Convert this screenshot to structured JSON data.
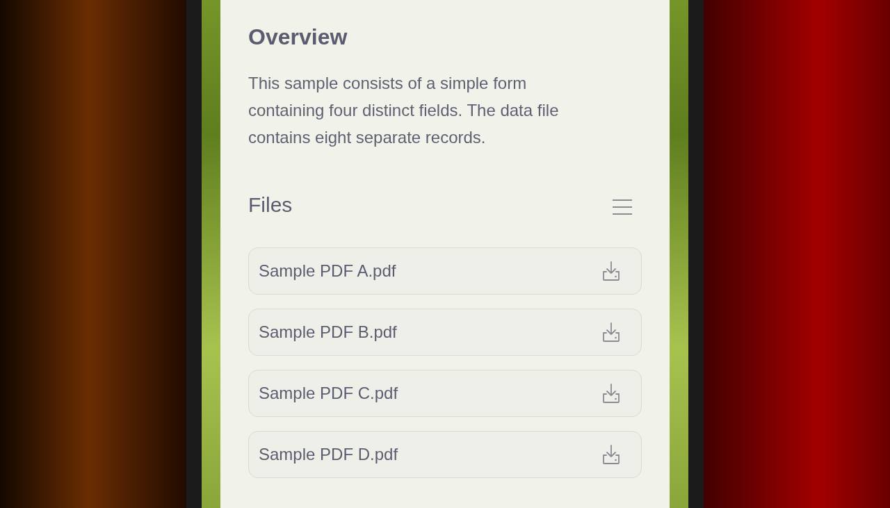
{
  "overview": {
    "title": "Overview",
    "description": "This sample consists of a simple form containing four distinct fields. The data file contains eight separate records."
  },
  "files": {
    "title": "Files",
    "items": [
      {
        "name": "Sample PDF A.pdf"
      },
      {
        "name": "Sample PDF B.pdf"
      },
      {
        "name": "Sample PDF C.pdf"
      },
      {
        "name": "Sample PDF D.pdf"
      }
    ]
  }
}
